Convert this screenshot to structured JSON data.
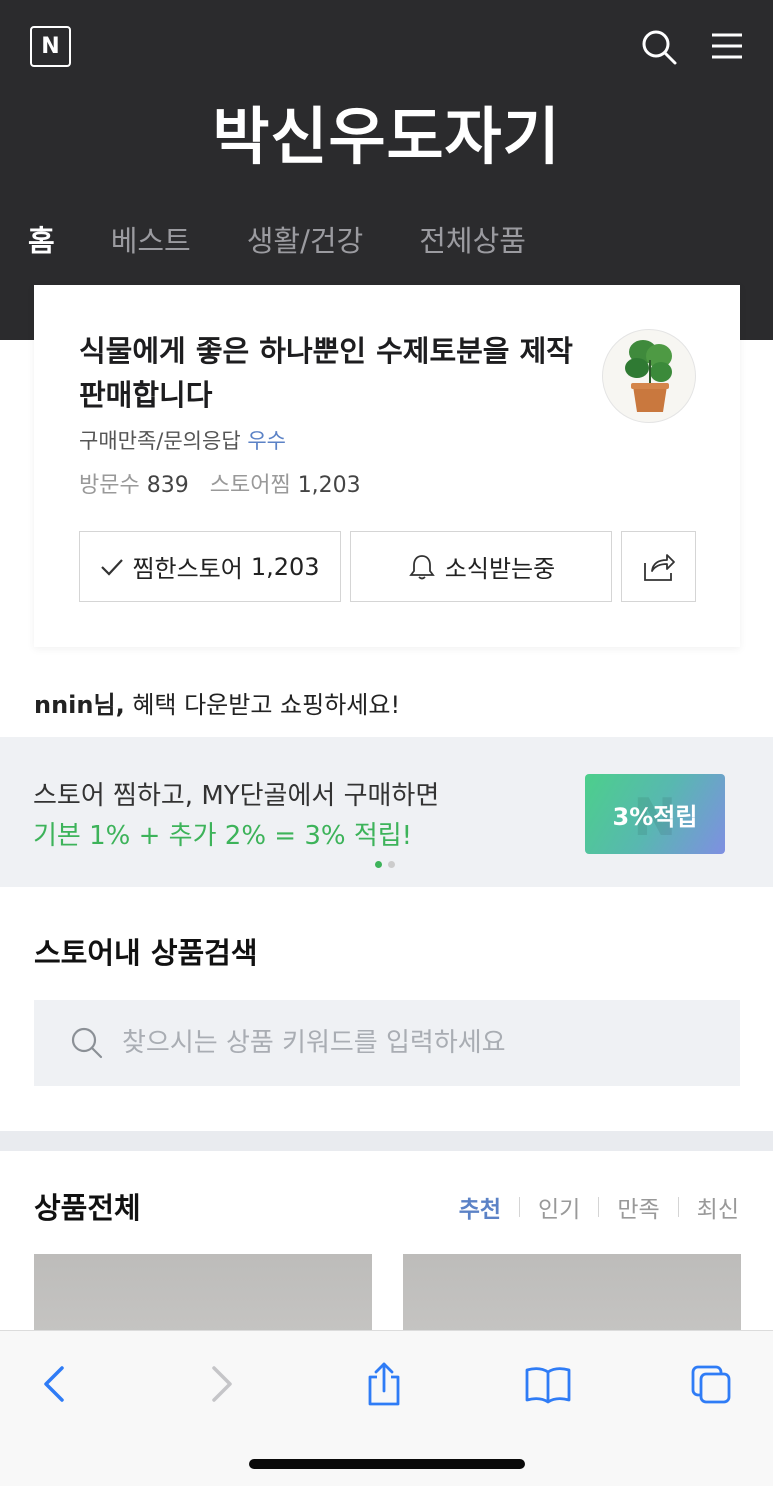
{
  "header": {
    "logo_text": "N",
    "store_name": "박신우도자기",
    "tabs": [
      {
        "label": "홈",
        "active": true
      },
      {
        "label": "베스트",
        "active": false
      },
      {
        "label": "생활/건강",
        "active": false
      },
      {
        "label": "전체상품",
        "active": false
      }
    ]
  },
  "profile": {
    "headline": "식물에게 좋은 하나뿐인 수제토분을 제작판매합니다",
    "rating_label": "구매만족/문의응답",
    "rating_value": "우수",
    "visits_label": "방문수",
    "visits_value": "839",
    "favs_label": "스토어찜",
    "favs_value": "1,203",
    "fav_button_label": "찜한스토어",
    "fav_button_count": "1,203",
    "noti_button_label": "소식받는중"
  },
  "greeting": {
    "user": "nnin님,",
    "message": " 혜택 다운받고 쇼핑하세요!"
  },
  "banner": {
    "line1": "스토어 찜하고, MY단골에서 구매하면",
    "line2": "기본 1% + 추가 2% = 3% 적립!",
    "badge_text": "3%적립",
    "badge_watermark": "N",
    "line2_color": "#3db35a",
    "page_count": 2,
    "active_page": 1
  },
  "search": {
    "title": "스토어내 상품검색",
    "placeholder": "찾으시는 상품 키워드를 입력하세요"
  },
  "products": {
    "title": "상품전체",
    "sort_options": [
      {
        "label": "추천",
        "active": true
      },
      {
        "label": "인기",
        "active": false
      },
      {
        "label": "만족",
        "active": false
      },
      {
        "label": "최신",
        "active": false
      }
    ]
  },
  "colors": {
    "header_bg": "#2b2b2d",
    "accent_blue": "#5b82c6",
    "accent_green": "#3db35a",
    "safari_blue": "#2f7cf6"
  },
  "browser_toolbar": {
    "icons": [
      "back-icon",
      "forward-icon",
      "share-icon",
      "bookmarks-icon",
      "tabs-icon"
    ]
  }
}
